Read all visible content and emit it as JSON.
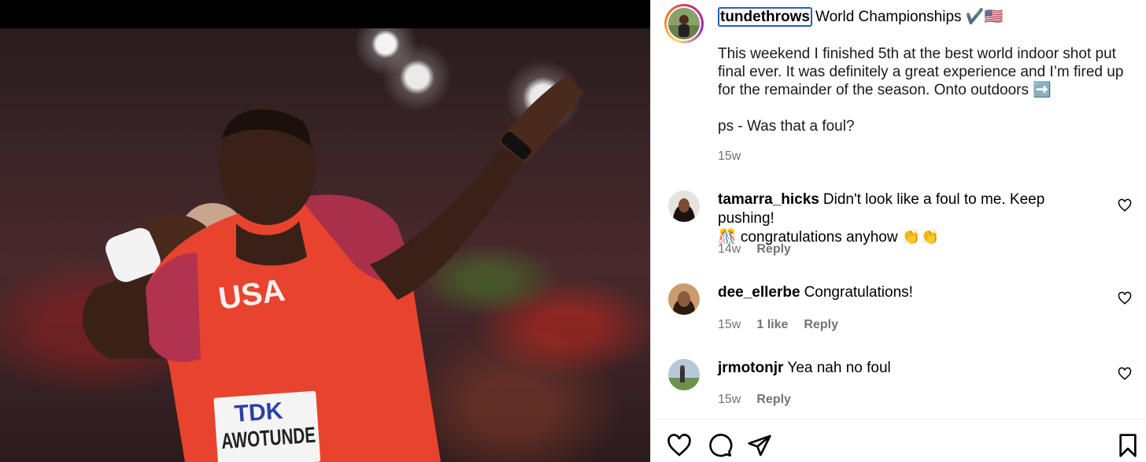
{
  "photo": {
    "alt": "Athlete in red USA kit posing after a shot put throw",
    "kit_text": "USA",
    "bib_brand": "TDK",
    "bib_name": "AWOTUNDE"
  },
  "post": {
    "author": "tundethrows",
    "title": "World Championships ✔️🇺🇸",
    "caption_p1": "This weekend I finished 5th at the best world indoor shot put final ever. It was definitely a great experience and I’m fired up for the remainder of the season. Onto outdoors ➡️",
    "caption_p2": "ps - Was that a foul?",
    "time": "15w"
  },
  "comments": [
    {
      "username": "tamarra_hicks",
      "text": "Didn't look like a foul to me. Keep pushing!",
      "text2": "🎊 congratulations anyhow 👏👏",
      "time": "14w",
      "likes": "",
      "reply": "Reply"
    },
    {
      "username": "dee_ellerbe",
      "text": "Congratulations!",
      "text2": "",
      "time": "15w",
      "likes": "1 like",
      "reply": "Reply"
    },
    {
      "username": "jrmotonjr",
      "text": "Yea nah no foul",
      "text2": "",
      "time": "15w",
      "likes": "",
      "reply": "Reply"
    }
  ],
  "icons": {
    "like": "heart-icon",
    "comment": "comment-icon",
    "share": "paper-plane-icon",
    "save": "bookmark-icon",
    "comment_like": "heart-icon"
  },
  "colors": {
    "story_ring_start": "#feda75",
    "story_ring_end": "#d62976",
    "focus_outline": "#1f5fbf",
    "secondary_text": "#737373",
    "divider": "#dbdbdb",
    "kit_red": "#e8432e"
  }
}
